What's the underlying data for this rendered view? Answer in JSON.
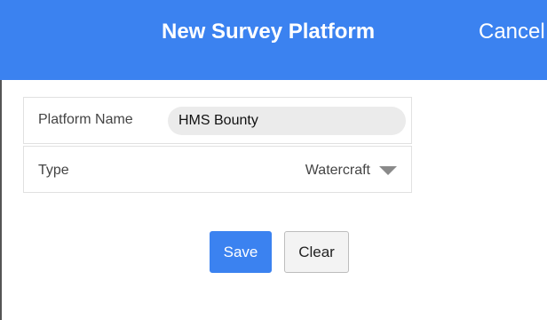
{
  "header": {
    "title": "New Survey Platform",
    "cancel_label": "Cancel"
  },
  "form": {
    "platform_name": {
      "label": "Platform Name",
      "value": "HMS Bounty"
    },
    "type": {
      "label": "Type",
      "selected": "Watercraft",
      "icon": "dropdown-triangle-icon"
    }
  },
  "actions": {
    "save_label": "Save",
    "clear_label": "Clear"
  },
  "colors": {
    "accent": "#3b82f0",
    "input_bg": "#ebebeb",
    "card_border": "#e1e1e1"
  }
}
